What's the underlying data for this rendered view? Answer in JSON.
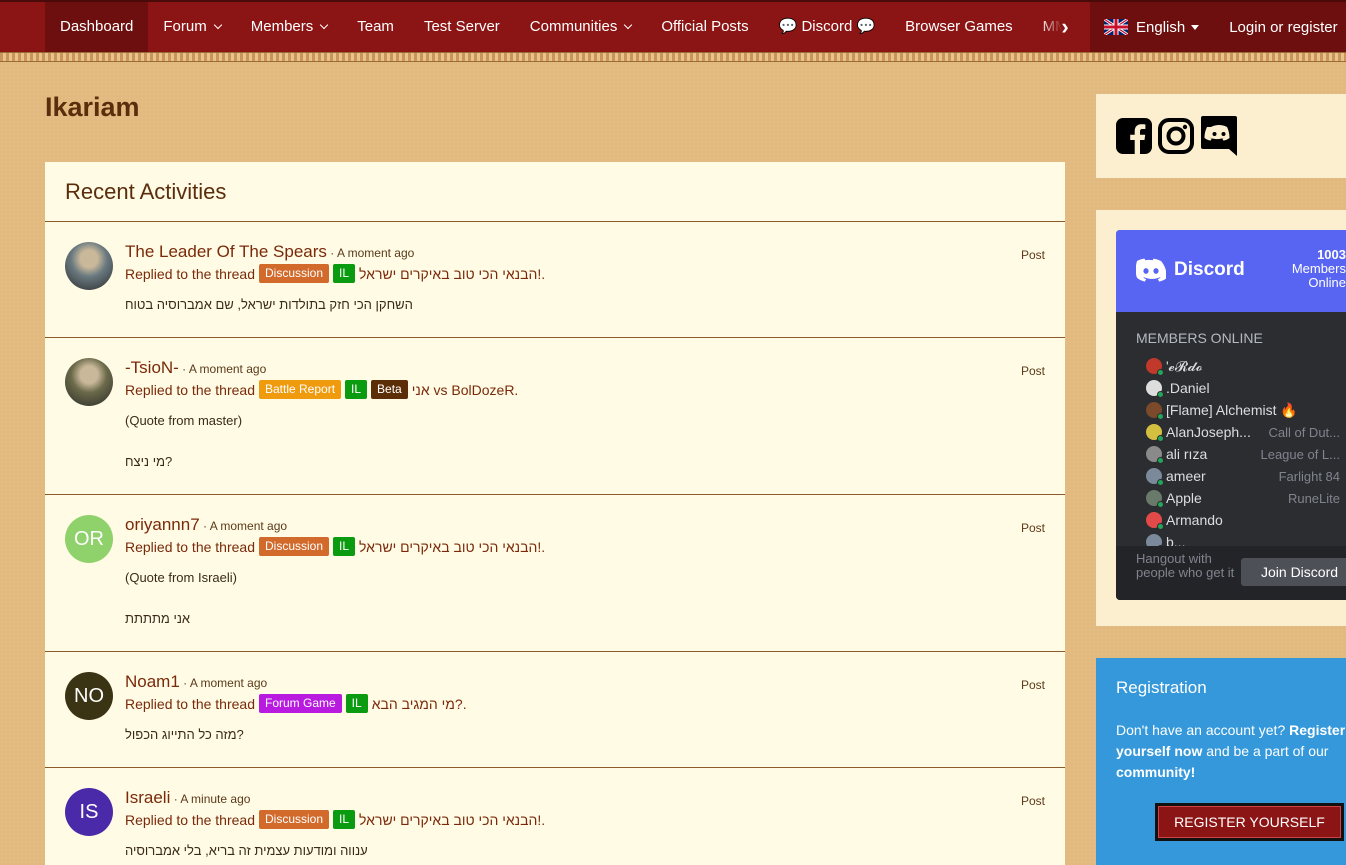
{
  "nav": {
    "items": [
      {
        "label": "Dashboard",
        "caret": false,
        "active": true
      },
      {
        "label": "Forum",
        "caret": true
      },
      {
        "label": "Members",
        "caret": true
      },
      {
        "label": "Team",
        "caret": false
      },
      {
        "label": "Test Server",
        "caret": false
      },
      {
        "label": "Communities",
        "caret": true
      },
      {
        "label": "Official Posts",
        "caret": false
      },
      {
        "label": "💬 Discord 💬",
        "caret": false
      },
      {
        "label": "Browser Games",
        "caret": false
      },
      {
        "label": "MMORPG",
        "caret": false
      }
    ],
    "language": "English",
    "login": "Login or register"
  },
  "page": {
    "title": "Ikariam"
  },
  "activities": {
    "header": "Recent Activities",
    "items": [
      {
        "user": "The Leader Of The Spears",
        "time": "A moment ago",
        "type": "Post",
        "action": "Replied to the thread",
        "badges": [
          {
            "label": "Discussion",
            "cls": "b-discussion"
          },
          {
            "label": "IL",
            "cls": "b-il"
          }
        ],
        "thread": "הבנאי הכי טוב באיקרים ישראל!.",
        "text1": "השחקן הכי חזק בתולדות ישראל, שם אמברוסיה בטוח",
        "text2": "",
        "avatar": "img",
        "avatarColor": "#6a7a80"
      },
      {
        "user": "-TsioN-",
        "time": "A moment ago",
        "type": "Post",
        "action": "Replied to the thread",
        "badges": [
          {
            "label": "Battle Report",
            "cls": "b-battle"
          },
          {
            "label": "IL",
            "cls": "b-il"
          },
          {
            "label": "Beta",
            "cls": "b-beta"
          }
        ],
        "thread": "אני vs BolDozeR.",
        "text1": "(Quote from master)",
        "text2": "מי ניצח?",
        "avatar": "img",
        "avatarColor": "#6b6a4a"
      },
      {
        "user": "oriyannn7",
        "time": "A moment ago",
        "type": "Post",
        "action": "Replied to the thread",
        "badges": [
          {
            "label": "Discussion",
            "cls": "b-discussion"
          },
          {
            "label": "IL",
            "cls": "b-il"
          }
        ],
        "thread": "הבנאי הכי טוב באיקרים ישראל!.",
        "text1": "(Quote from Israeli)",
        "text2": "אני מתתתת",
        "avatar": "OR",
        "avatarColor": "#8fd16a"
      },
      {
        "user": "Noam1",
        "time": "A moment ago",
        "type": "Post",
        "action": "Replied to the thread",
        "badges": [
          {
            "label": "Forum Game",
            "cls": "b-forumgame"
          },
          {
            "label": "IL",
            "cls": "b-il"
          }
        ],
        "thread": "מי המגיב הבא?.",
        "text1": "מזה כל התייוג הכפול?",
        "text2": "",
        "avatar": "NO",
        "avatarColor": "#3a3414"
      },
      {
        "user": "Israeli",
        "time": "A minute ago",
        "type": "Post",
        "action": "Replied to the thread",
        "badges": [
          {
            "label": "Discussion",
            "cls": "b-discussion"
          },
          {
            "label": "IL",
            "cls": "b-il"
          }
        ],
        "thread": "הבנאי הכי טוב באיקרים ישראל!.",
        "text1": "ענווה ומודעות עצמית זה בריא, בלי אמברוסיה",
        "text2": "",
        "avatar": "IS",
        "avatarColor": "#4a2aa8"
      }
    ]
  },
  "discord": {
    "brand": "Discord",
    "count": "1003",
    "count_label1": "Members",
    "count_label2": "Online",
    "members_title": "MEMBERS ONLINE",
    "members": [
      {
        "name": "'𝓮𝓡𝓭𝓸",
        "game": "",
        "color": "#c0392b"
      },
      {
        "name": ".Daniel",
        "game": "",
        "color": "#ddd"
      },
      {
        "name": "[Flame] Alchemist 🔥",
        "game": "",
        "color": "#7a4a2a"
      },
      {
        "name": "AlanJoseph...",
        "game": "Call of Dut...",
        "color": "#d4c040"
      },
      {
        "name": "ali rıza",
        "game": "League of L...",
        "color": "#8a8a8a"
      },
      {
        "name": "ameer",
        "game": "Farlight 84",
        "color": "#7a8a9a"
      },
      {
        "name": "Apple",
        "game": "RuneLite",
        "color": "#6a7a6a"
      },
      {
        "name": "Armando",
        "game": "",
        "color": "#e24a4a"
      },
      {
        "name": "b...",
        "game": "",
        "color": "#7a8a9a"
      }
    ],
    "footer_text": "Hangout with people who get it",
    "join": "Join Discord"
  },
  "registration": {
    "title": "Registration",
    "text_plain1": "Don't have an account yet? ",
    "text_bold": "Register yourself now",
    "text_plain2": " and be a part of our ",
    "text_bold2": "community!",
    "button": "REGISTER YOURSELF"
  }
}
